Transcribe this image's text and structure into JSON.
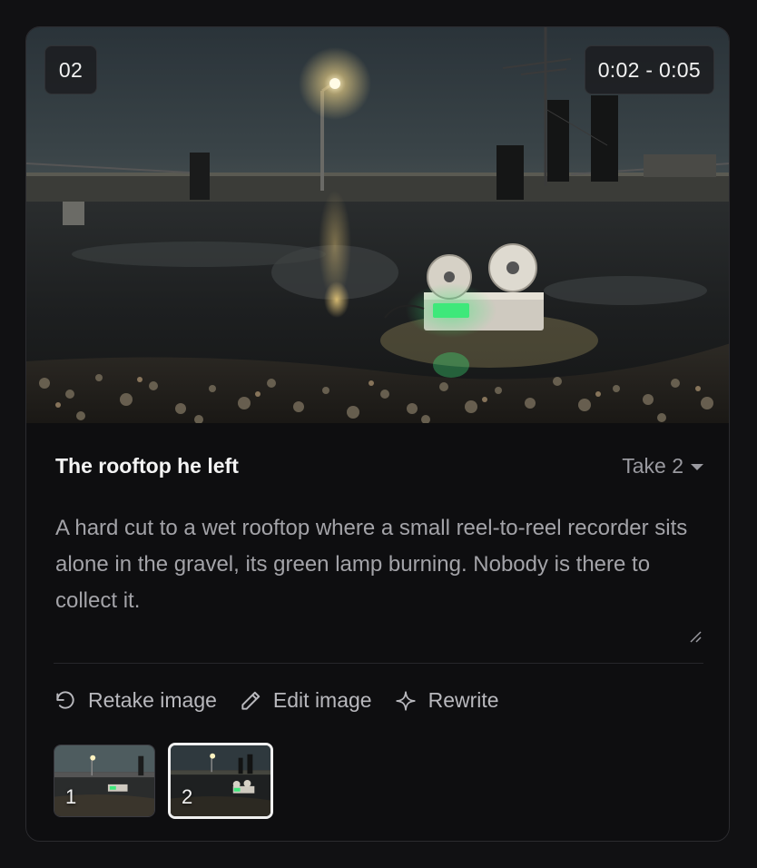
{
  "scene": {
    "number": "02",
    "time_range": "0:02 - 0:05",
    "image_icon": "rooftop-reel-to-reel-image"
  },
  "shot": {
    "title": "The rooftop he left",
    "take_selector": "Take 2",
    "description": "A hard cut to a wet rooftop where a small reel-to-reel recorder sits alone in the gravel, its green lamp burning. Nobody is there to collect it."
  },
  "actions": {
    "retake": "Retake image",
    "edit": "Edit image",
    "rewrite": "Rewrite"
  },
  "takes": [
    {
      "label": "1",
      "selected": false
    },
    {
      "label": "2",
      "selected": true
    }
  ],
  "colors": {
    "background": "#111113",
    "card": "#0e0e10",
    "text_primary": "#f4f4f4",
    "text_muted": "#a3a3a8",
    "lamp_green": "#3ee87a"
  }
}
